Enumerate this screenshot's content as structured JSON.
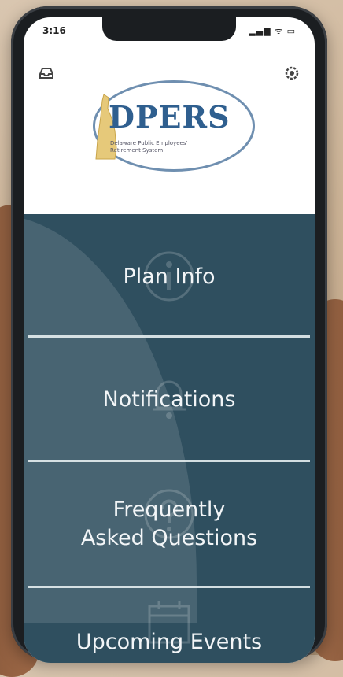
{
  "status_bar": {
    "time": "3:16",
    "icons": "▂▄▆ ᯤ ▭"
  },
  "logo": {
    "title": "DPERS",
    "subtitle_line1": "Delaware Public Employees'",
    "subtitle_line2": "Retirement System"
  },
  "menu": {
    "items": [
      {
        "label_line1": "Plan Info",
        "label_line2": ""
      },
      {
        "label_line1": "Notifications",
        "label_line2": ""
      },
      {
        "label_line1": "Frequently",
        "label_line2": "Asked Questions"
      },
      {
        "label_line1": "Upcoming Events",
        "label_line2": ""
      }
    ]
  },
  "colors": {
    "menu_bg": "#2f4f5f",
    "accent": "#2f5f8f"
  }
}
